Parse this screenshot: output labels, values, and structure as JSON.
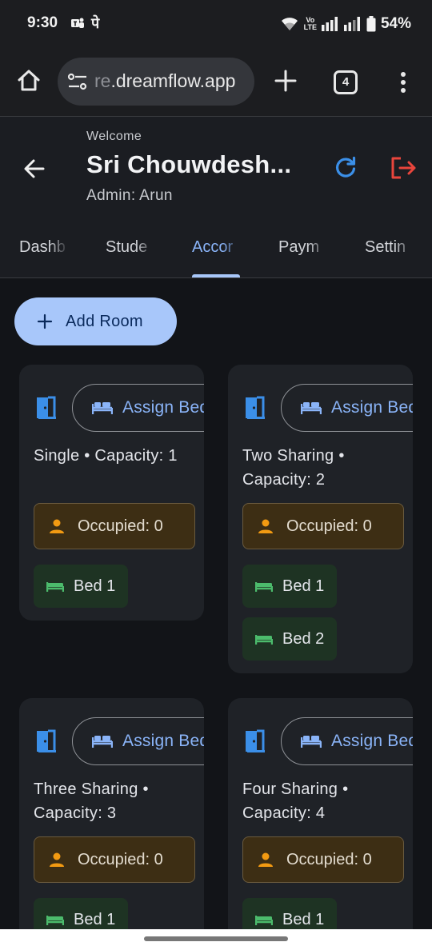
{
  "status_bar": {
    "time": "9:30",
    "extra_glyph": "पे",
    "network_label_top": "Vo",
    "network_label_bottom": "LTE",
    "battery": "54%"
  },
  "browser": {
    "url_faded": "re",
    "url_rest": ".dreamflow.app",
    "tab_count": "4"
  },
  "header": {
    "welcome": "Welcome",
    "title": "Sri Chouwdesh...",
    "admin": "Admin: Arun"
  },
  "tabs": [
    {
      "label": "Dashb",
      "active": false
    },
    {
      "label": "Stude",
      "active": false
    },
    {
      "label": "Accor",
      "active": true
    },
    {
      "label": "Paym",
      "active": false
    },
    {
      "label": "Settin",
      "active": false
    }
  ],
  "add_room": {
    "label": "Add Room"
  },
  "rooms": [
    {
      "assign_label": "Assign Bed",
      "description": "Single • Capacity: 1",
      "occupied": "Occupied: 0",
      "beds": [
        "Bed 1"
      ]
    },
    {
      "assign_label": "Assign Bed",
      "description": "Two Sharing • Capacity: 2",
      "occupied": "Occupied: 0",
      "beds": [
        "Bed 1",
        "Bed 2"
      ]
    },
    {
      "assign_label": "Assign Bed",
      "description": "Three Sharing • Capacity: 3",
      "occupied": "Occupied: 0",
      "beds": [
        "Bed 1"
      ]
    },
    {
      "assign_label": "Assign Bed",
      "description": "Four Sharing • Capacity: 4",
      "occupied": "Occupied: 0",
      "beds": [
        "Bed 1"
      ]
    }
  ],
  "colors": {
    "accent_blue": "#8ab4f8",
    "logout_red": "#e8453c",
    "occupied_orange": "#f29a12",
    "bed_green": "#4cbb6c"
  },
  "icons": {
    "room": "door-icon",
    "assign": "bed-icon",
    "occupied": "person-icon",
    "bed": "bed-icon",
    "refresh": "refresh-icon",
    "logout": "logout-icon"
  }
}
